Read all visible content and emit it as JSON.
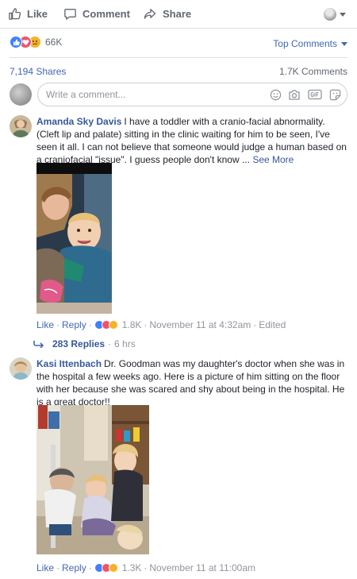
{
  "colors": {
    "link": "#4267b2",
    "author": "#365899",
    "meta": "#90949c",
    "like": "#4080ff",
    "love": "#f25268",
    "sad": "#f7b125"
  },
  "actions": {
    "like": "Like",
    "comment": "Comment",
    "share": "Share"
  },
  "post_stats": {
    "reaction_icons": [
      "like-icon",
      "love-icon",
      "sad-icon"
    ],
    "reaction_count": "66K",
    "sort_label": "Top Comments",
    "shares": "7,194 Shares",
    "comments": "1.7K Comments"
  },
  "composer": {
    "placeholder": "Write a comment...",
    "icons": [
      "emoji-icon",
      "camera-icon",
      "gif-icon",
      "sticker-icon"
    ]
  },
  "comments": [
    {
      "author": "Amanda Sky Davis",
      "text": "I have a toddler with a cranio-facial abnormality. (Cleft lip and palate) sitting in the clinic waiting for him to be seen, I've seen it all. I can not believe that someone would judge a human based on a craniofacial \"issue\". I guess people don't know ...",
      "see_more": "See More",
      "like": "Like",
      "reply": "Reply",
      "reaction_count": "1.8K",
      "timestamp": "November 11 at 4:32am",
      "edited": "Edited",
      "replies_count": "283 Replies",
      "replies_age": "6 hrs"
    },
    {
      "author": "Kasi Ittenbach",
      "text": "Dr. Goodman was my daughter's doctor when she was in the hospital a few weeks ago. Here is a picture of him sitting on the floor with her because she was scared and shy about being in the hospital. He is a great doctor!!",
      "like": "Like",
      "reply": "Reply",
      "reaction_count": "1.3K",
      "timestamp": "November 11 at 11:00am"
    }
  ]
}
